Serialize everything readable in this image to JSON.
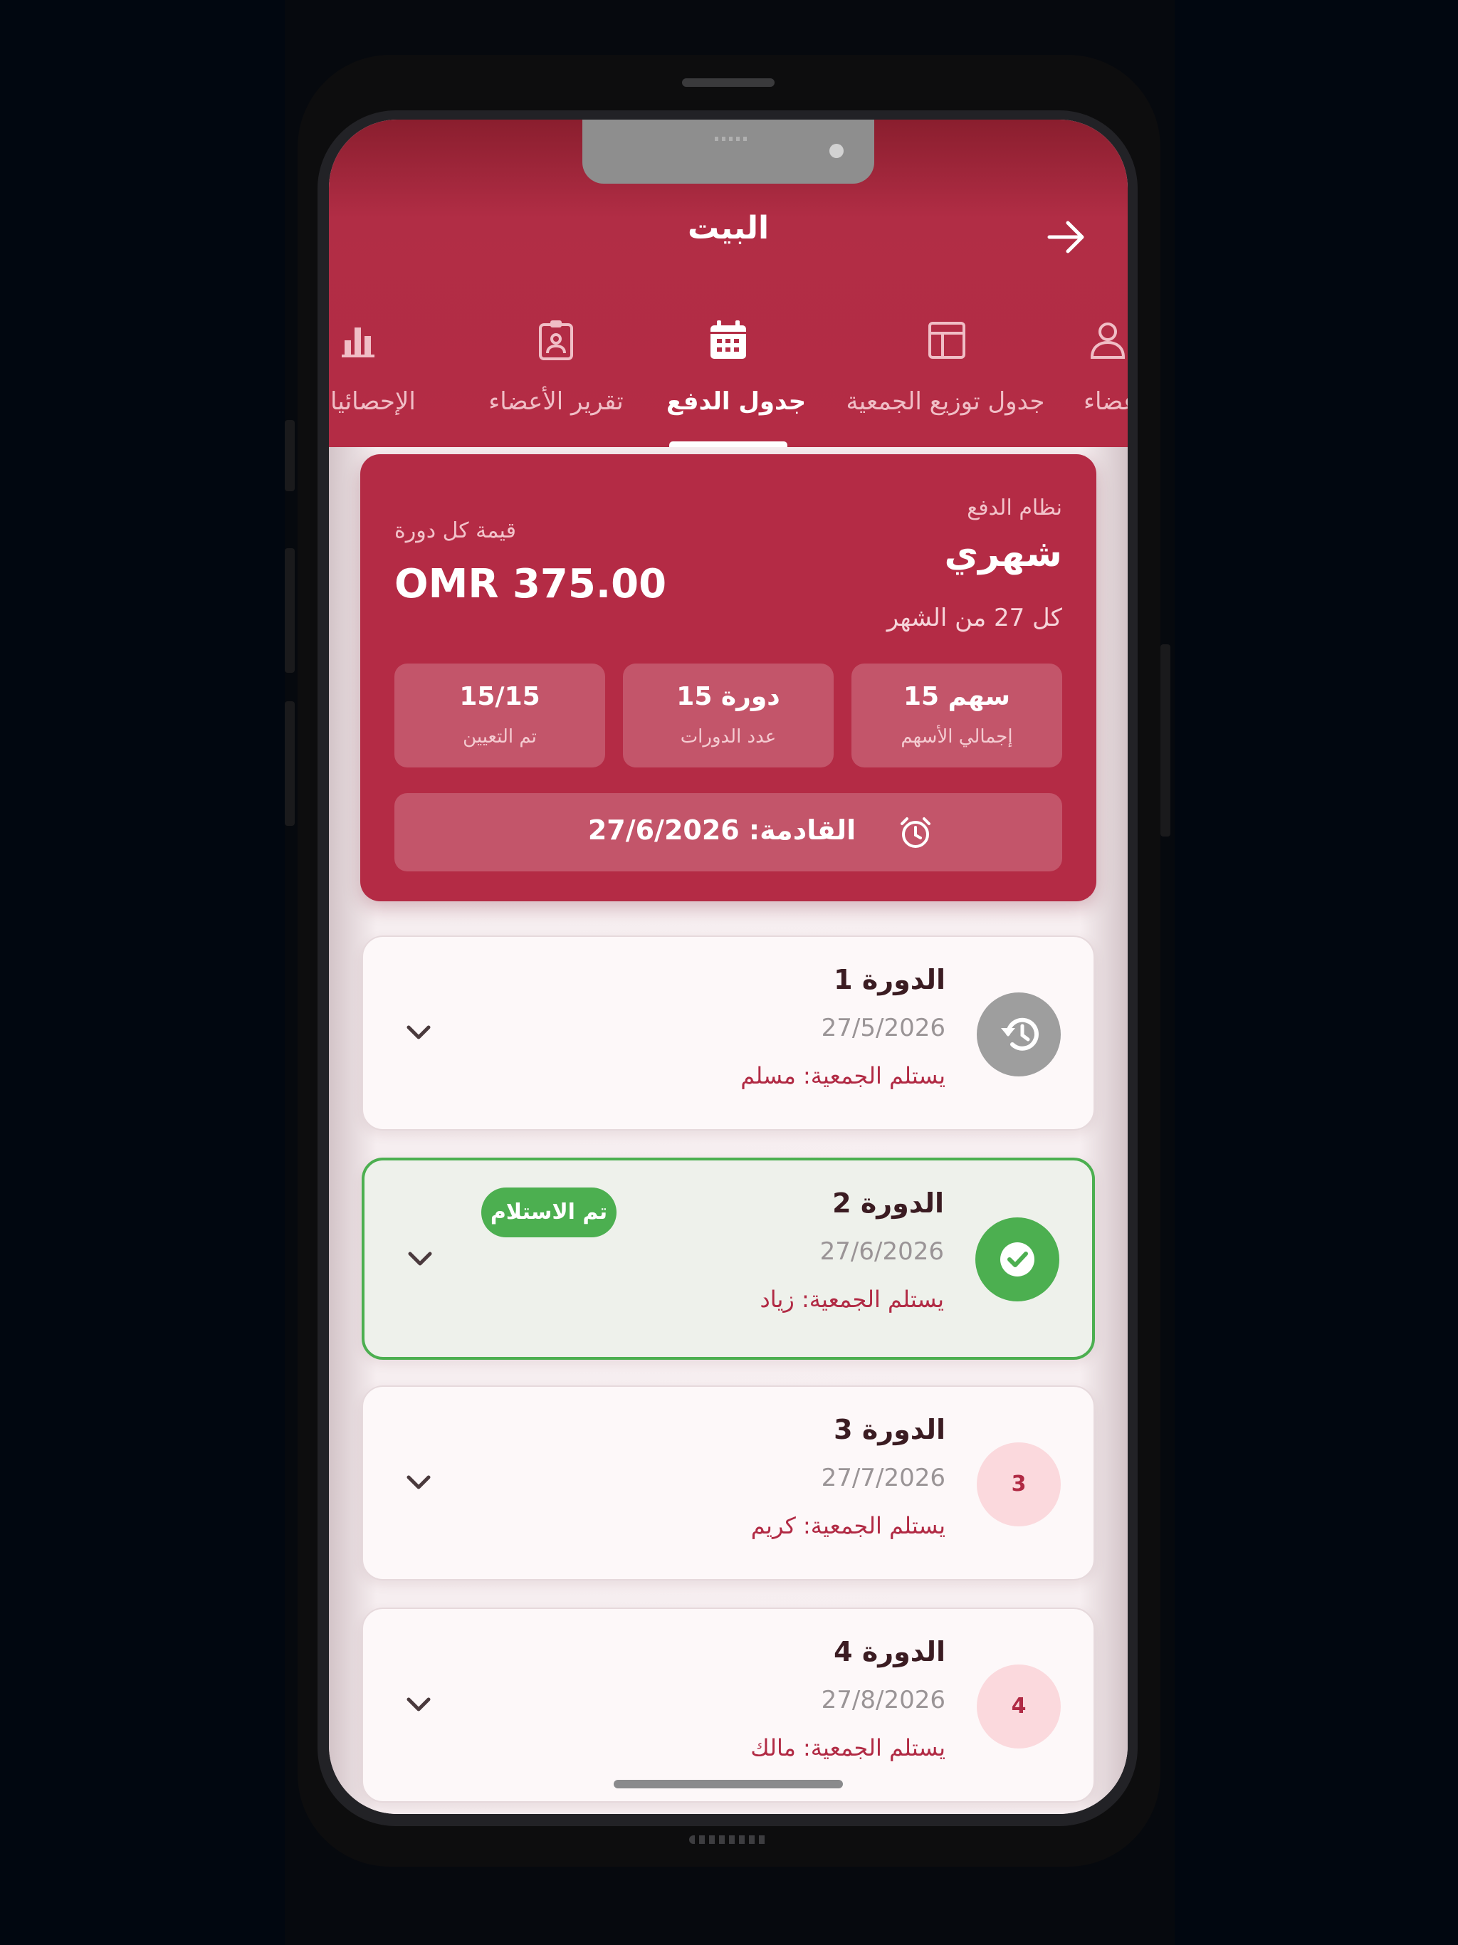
{
  "app": {
    "title": "البيت"
  },
  "tabs": [
    {
      "id": "statistics",
      "label": "الإحصائيات",
      "icon": "bar-chart-icon"
    },
    {
      "id": "members-report",
      "label": "تقرير الأعضاء",
      "icon": "id-badge-icon"
    },
    {
      "id": "payment-schedule",
      "label": "جدول الدفع",
      "icon": "calendar-icon",
      "active": true
    },
    {
      "id": "distribution-schedule",
      "label": "جدول توزيع الجمعية",
      "icon": "table-layout-icon"
    },
    {
      "id": "members",
      "label": "الأعضاء",
      "icon": "person-icon"
    }
  ],
  "summary": {
    "payment_system_label": "نظام الدفع",
    "payment_system_value": "شهري",
    "payment_day": "كل 27 من الشهر",
    "cycle_value_label": "قيمة كل دورة",
    "cycle_value": "OMR 375.00",
    "stats": [
      {
        "value": "15 سهم",
        "label": "إجمالي الأسهم"
      },
      {
        "value": "15 دورة",
        "label": "عدد الدورات"
      },
      {
        "value": "15/15",
        "label": "تم التعيين"
      }
    ],
    "next_due": "القادمة: 27/6/2026",
    "icons": {
      "next_due": "alarm-clock-icon"
    }
  },
  "cycles": [
    {
      "title": "الدورة 1",
      "date": "27/5/2026",
      "receiver": "يستلم الجمعية: مسلم",
      "status": "past",
      "badge": "history-icon",
      "badge_text": ""
    },
    {
      "title": "الدورة 2",
      "date": "27/6/2026",
      "receiver": "يستلم الجمعية: زياد",
      "status": "received",
      "badge": "check-circle-icon",
      "badge_text": "",
      "status_label": "تم الاستلام"
    },
    {
      "title": "الدورة 3",
      "date": "27/7/2026",
      "receiver": "يستلم الجمعية: كريم",
      "status": "upcoming",
      "badge": "number-badge",
      "badge_text": "3"
    },
    {
      "title": "الدورة 4",
      "date": "27/8/2026",
      "receiver": "يستلم الجمعية: مالك",
      "status": "upcoming",
      "badge": "number-badge",
      "badge_text": "4"
    }
  ],
  "colors": {
    "primary": "#b42c45",
    "header_dark": "#8a1e2e",
    "success": "#4caf50",
    "past": "#9e9e9e",
    "upcoming_badge": "#fbd9dd"
  }
}
